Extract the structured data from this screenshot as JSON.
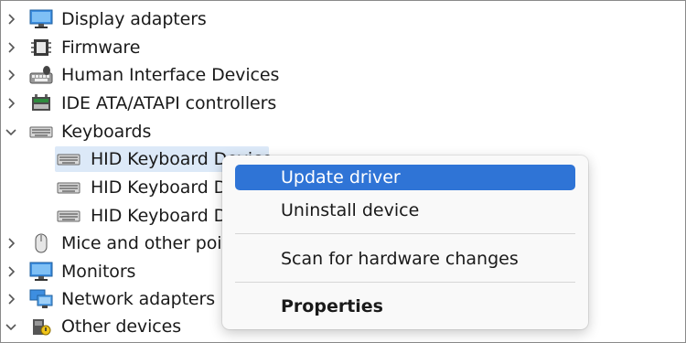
{
  "tree": {
    "items": [
      {
        "label": "Display adapters",
        "icon": "monitor-icon",
        "expanded": false
      },
      {
        "label": "Firmware",
        "icon": "chip-icon",
        "expanded": false
      },
      {
        "label": "Human Interface Devices",
        "icon": "hid-icon",
        "expanded": false
      },
      {
        "label": "IDE ATA/ATAPI controllers",
        "icon": "disk-controller-icon",
        "expanded": false
      },
      {
        "label": "Keyboards",
        "icon": "keyboard-icon",
        "expanded": true,
        "children": [
          {
            "label": "HID Keyboard Device",
            "icon": "keyboard-icon",
            "selected": true
          },
          {
            "label": "HID Keyboard Device",
            "icon": "keyboard-icon"
          },
          {
            "label": "HID Keyboard Device",
            "icon": "keyboard-icon"
          }
        ]
      },
      {
        "label": "Mice and other pointing devices",
        "icon": "mouse-icon",
        "expanded": false
      },
      {
        "label": "Monitors",
        "icon": "monitor-icon",
        "expanded": false
      },
      {
        "label": "Network adapters",
        "icon": "network-icon",
        "expanded": false
      },
      {
        "label": "Other devices",
        "icon": "unknown-device-icon",
        "expanded": true
      }
    ]
  },
  "context_menu": {
    "items": [
      {
        "label": "Update driver",
        "highlighted": true
      },
      {
        "label": "Uninstall device"
      },
      {
        "label": "Scan for hardware changes"
      },
      {
        "label": "Properties",
        "bold": true
      }
    ]
  },
  "colors": {
    "selection": "#dce9f8",
    "menu_highlight": "#2f74d6",
    "menu_background": "#f9f9f9"
  }
}
